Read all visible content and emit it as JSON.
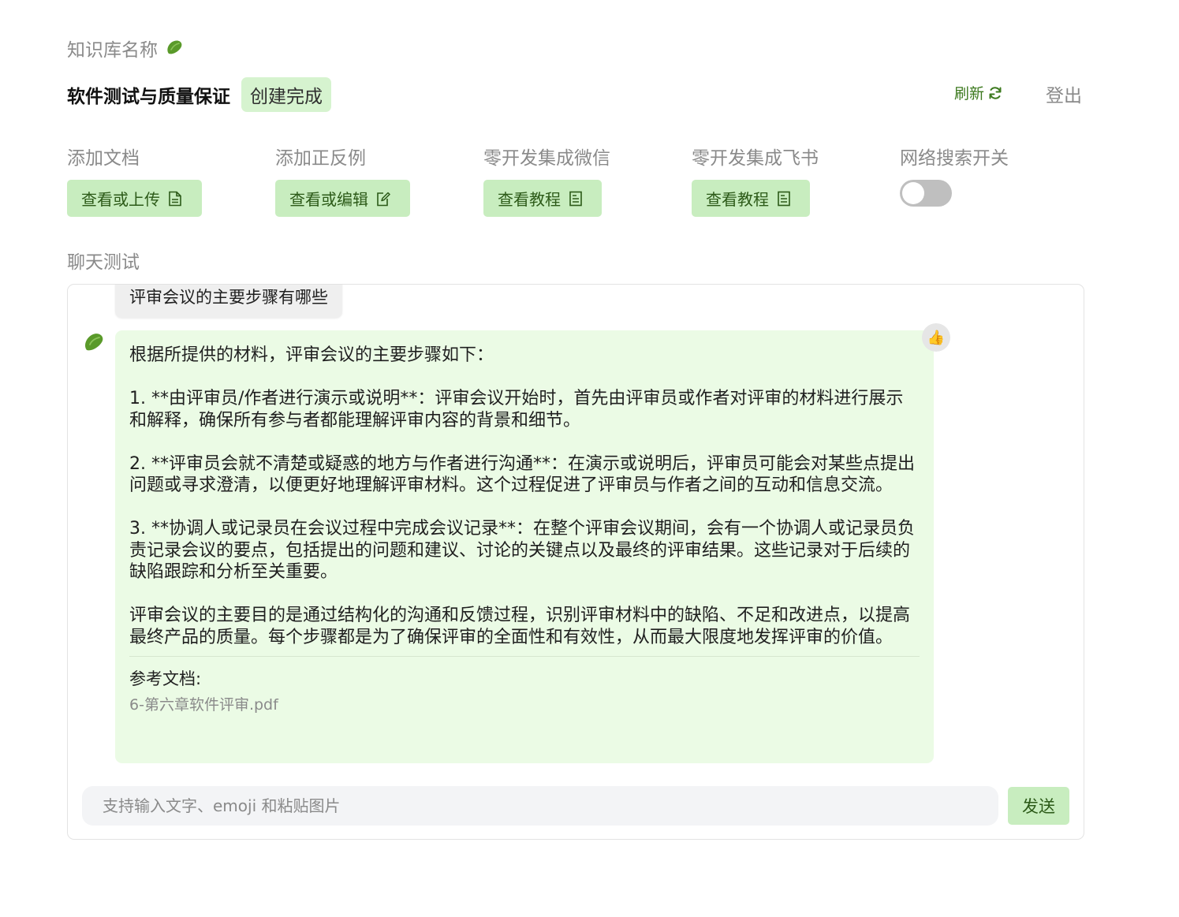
{
  "header": {
    "kb_label": "知识库名称",
    "kb_name": "软件测试与质量保证",
    "status": "创建完成",
    "refresh_label": "刷新",
    "logout_label": "登出"
  },
  "features": [
    {
      "title": "添加文档",
      "button": "查看或上传",
      "icon": "document-upload-icon"
    },
    {
      "title": "添加正反例",
      "button": "查看或编辑",
      "icon": "edit-icon"
    },
    {
      "title": "零开发集成微信",
      "button": "查看教程",
      "icon": "document-icon"
    },
    {
      "title": "零开发集成飞书",
      "button": "查看教程",
      "icon": "document-icon"
    },
    {
      "title": "网络搜索开关",
      "toggle": false
    }
  ],
  "chat": {
    "label": "聊天测试",
    "user_message": "评审会议的主要步骤有哪些",
    "answer_paragraphs": [
      "根据所提供的材料，评审会议的主要步骤如下：",
      "1. **由评审员/作者进行演示或说明**：评审会议开始时，首先由评审员或作者对评审的材料进行展示和解释，确保所有参与者都能理解评审内容的背景和细节。",
      "2. **评审员会就不清楚或疑惑的地方与作者进行沟通**：在演示或说明后，评审员可能会对某些点提出问题或寻求澄清，以便更好地理解评审材料。这个过程促进了评审员与作者之间的互动和信息交流。",
      "3. **协调人或记录员在会议过程中完成会议记录**：在整个评审会议期间，会有一个协调人或记录员负责记录会议的要点，包括提出的问题和建议、讨论的关键点以及最终的评审结果。这些记录对于后续的缺陷跟踪和分析至关重要。",
      "评审会议的主要目的是通过结构化的沟通和反馈过程，识别评审材料中的缺陷、不足和改进点，以提高最终产品的质量。每个步骤都是为了确保评审的全面性和有效性，从而最大限度地发挥评审的价值。"
    ],
    "refs_title": "参考文档:",
    "refs": [
      "6-第六章软件评审.pdf"
    ],
    "input_placeholder": "支持输入文字、emoji 和粘贴图片",
    "send_label": "发送"
  },
  "colors": {
    "accent_green": "#c8edbf",
    "answer_bg": "#ebfbe5",
    "brand_dark_green": "#3d7a1f",
    "muted_text": "#8a8a8a"
  }
}
